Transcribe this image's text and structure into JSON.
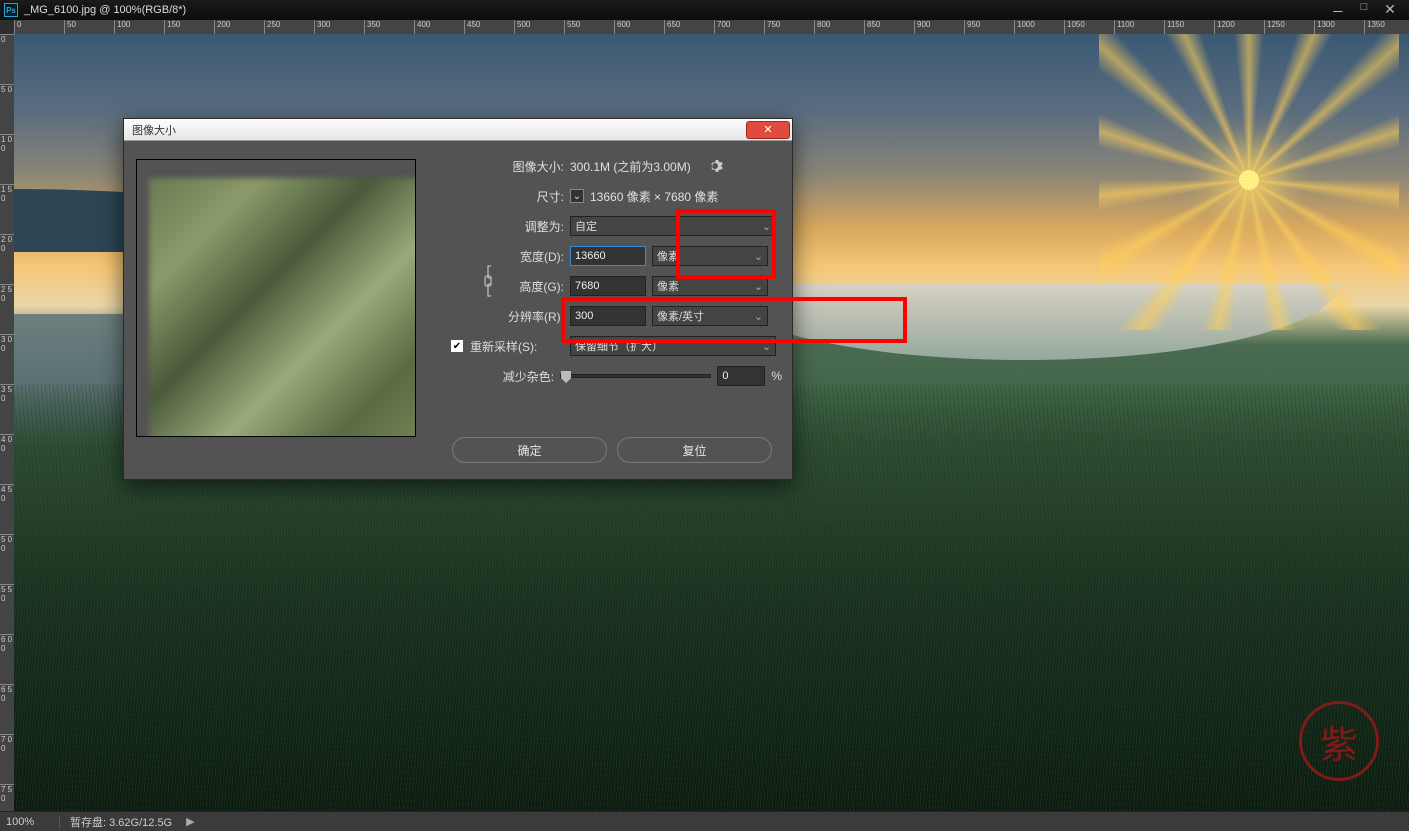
{
  "titlebar": {
    "document": "_MG_6100.jpg @ 100%(RGB/8*)"
  },
  "ruler": {
    "h": [
      "0",
      "50",
      "100",
      "150",
      "200",
      "250",
      "300",
      "350",
      "400",
      "450",
      "500",
      "550",
      "600",
      "650",
      "700",
      "750",
      "800",
      "850",
      "900",
      "950",
      "1000",
      "1050",
      "1100",
      "1150",
      "1200",
      "1250",
      "1300",
      "1350"
    ],
    "v": [
      "0",
      "5 0",
      "1 0 0",
      "1 5 0",
      "2 0 0",
      "2 5 0",
      "3 0 0",
      "3 5 0",
      "4 0 0",
      "4 5 0",
      "5 0 0",
      "5 5 0",
      "6 0 0",
      "6 5 0",
      "7 0 0",
      "7 5 0"
    ]
  },
  "dialog": {
    "title": "图像大小",
    "image_size_label": "图像大小:",
    "image_size_value": "300.1M (之前为3.00M)",
    "dim_label": "尺寸:",
    "dim_value": "13660 像素 × 7680 像素",
    "adjust_label": "调整为:",
    "adjust_value": "自定",
    "width_label": "宽度(D):",
    "width_value": "13660",
    "width_unit": "像素",
    "height_label": "高度(G):",
    "height_value": "7680",
    "height_unit": "像素",
    "res_label": "分辨率(R):",
    "res_value": "300",
    "res_unit": "像素/英寸",
    "resample_label": "重新采样(S):",
    "resample_value": "保留细节（扩大）",
    "noise_label": "减少杂色:",
    "noise_value": "0",
    "noise_unit": "%",
    "ok": "确定",
    "reset": "复位"
  },
  "status": {
    "zoom": "100%",
    "scratch_label": "暂存盘:",
    "scratch_value": "3.62G/12.5G"
  }
}
